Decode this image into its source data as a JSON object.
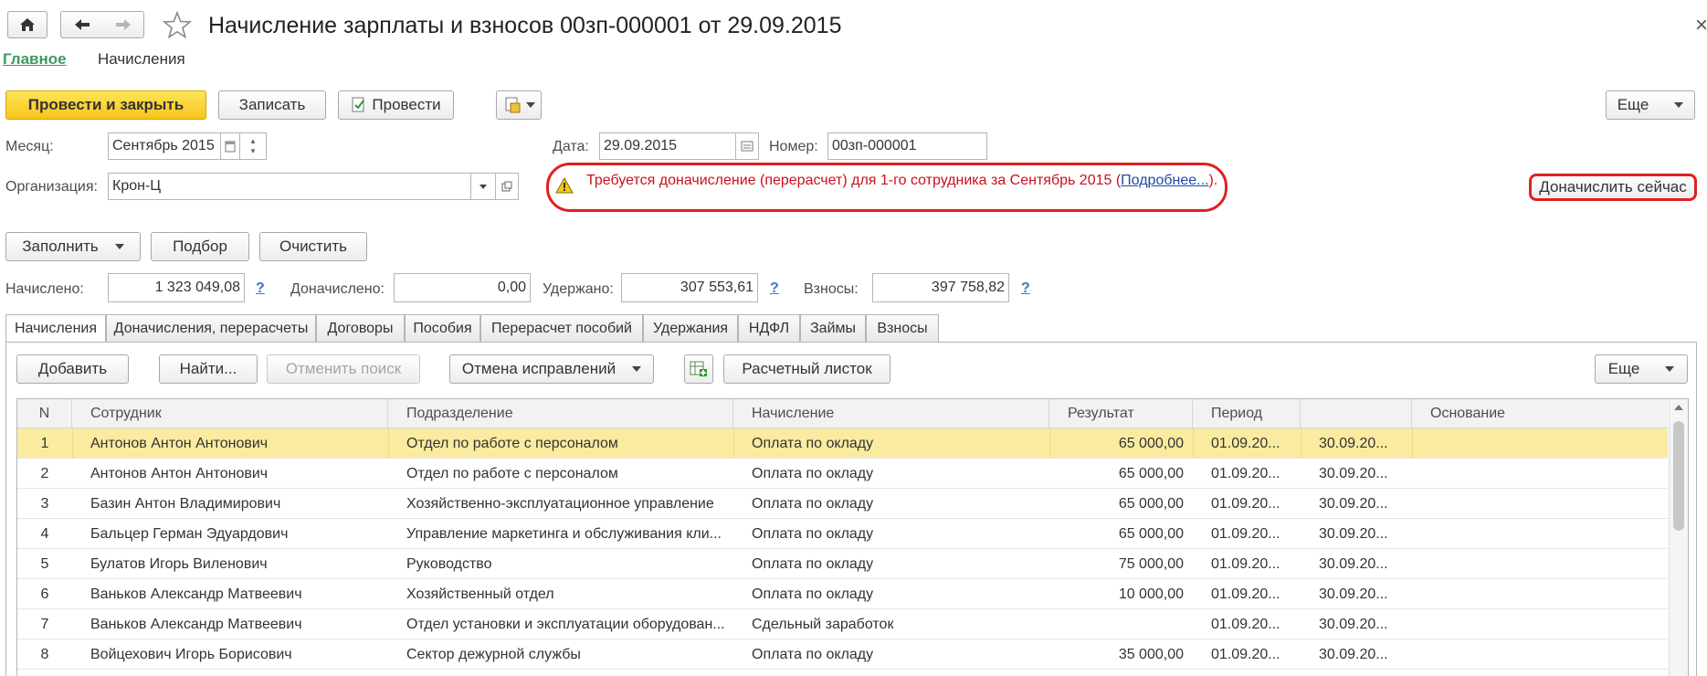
{
  "window": {
    "title": "Начисление зарплаты и взносов 00зп-000001 от 29.09.2015",
    "close_glyph": "×"
  },
  "nav": {
    "home_icon": "home-icon",
    "back_icon": "arrow-left-icon",
    "forward_icon": "arrow-right-icon",
    "star_icon": "star-icon",
    "links": [
      "Главное",
      "Начисления"
    ]
  },
  "toolbar": {
    "post_close": "Провести и закрыть",
    "save": "Записать",
    "post": "Провести",
    "more": "Еще"
  },
  "header": {
    "month_label": "Месяц:",
    "month_value": "Сентябрь 2015",
    "org_label": "Организация:",
    "org_value": "Крон-Ц",
    "date_label": "Дата:",
    "date_value": "29.09.2015",
    "number_label": "Номер:",
    "number_value": "00зп-000001"
  },
  "warning": {
    "text": "Требуется доначисление (перерасчет) для 1-го сотрудника за Сентябрь 2015 (",
    "link": "Подробнее...",
    "suffix": ").",
    "action_button": "Доначислить сейчас",
    "highlight_color": "#e02020"
  },
  "actions": {
    "fill": "Заполнить",
    "select": "Подбор",
    "clear": "Очистить"
  },
  "totals": {
    "accrued_label": "Начислено:",
    "accrued_value": "1 323 049,08",
    "extra_label": "Доначислено:",
    "extra_value": "0,00",
    "withheld_label": "Удержано:",
    "withheld_value": "307 553,61",
    "contrib_label": "Взносы:",
    "contrib_value": "397 758,82",
    "help": "?"
  },
  "tabs": [
    "Начисления",
    "Доначисления, перерасчеты",
    "Договоры",
    "Пособия",
    "Перерасчет пособий",
    "Удержания",
    "НДФЛ",
    "Займы",
    "Взносы"
  ],
  "grid_toolbar": {
    "add": "Добавить",
    "find": "Найти...",
    "cancel_search": "Отменить поиск",
    "cancel_fix": "Отмена исправлений",
    "payslip": "Расчетный листок",
    "more": "Еще"
  },
  "table": {
    "columns": [
      "N",
      "Сотрудник",
      "Подразделение",
      "Начисление",
      "Результат",
      "Период",
      "",
      "Основание"
    ],
    "rows": [
      {
        "n": "1",
        "employee": "Антонов Антон Антонович",
        "dept": "Отдел по работе с персоналом",
        "accrual": "Оплата по окладу",
        "result": "65 000,00",
        "from": "01.09.20...",
        "to": "30.09.20...",
        "basis": ""
      },
      {
        "n": "2",
        "employee": "Антонов Антон Антонович",
        "dept": "Отдел по работе с персоналом",
        "accrual": "Оплата по окладу",
        "result": "65 000,00",
        "from": "01.09.20...",
        "to": "30.09.20...",
        "basis": ""
      },
      {
        "n": "3",
        "employee": "Базин Антон Владимирович",
        "dept": "Хозяйственно-эксплуатационное управление",
        "accrual": "Оплата по окладу",
        "result": "65 000,00",
        "from": "01.09.20...",
        "to": "30.09.20...",
        "basis": ""
      },
      {
        "n": "4",
        "employee": "Бальцер Герман Эдуардович",
        "dept": "Управление маркетинга и обслуживания кли...",
        "accrual": "Оплата по окладу",
        "result": "65 000,00",
        "from": "01.09.20...",
        "to": "30.09.20...",
        "basis": ""
      },
      {
        "n": "5",
        "employee": "Булатов Игорь Виленович",
        "dept": "Руководство",
        "accrual": "Оплата по окладу",
        "result": "75 000,00",
        "from": "01.09.20...",
        "to": "30.09.20...",
        "basis": ""
      },
      {
        "n": "6",
        "employee": "Ваньков Александр Матвеевич",
        "dept": "Хозяйственный отдел",
        "accrual": "Оплата по окладу",
        "result": "10 000,00",
        "from": "01.09.20...",
        "to": "30.09.20...",
        "basis": ""
      },
      {
        "n": "7",
        "employee": "Ваньков Александр Матвеевич",
        "dept": "Отдел установки и эксплуатации оборудован...",
        "accrual": "Сдельный заработок",
        "result": "",
        "from": "01.09.20...",
        "to": "30.09.20...",
        "basis": ""
      },
      {
        "n": "8",
        "employee": "Войцехович Игорь Борисович",
        "dept": "Сектор дежурной службы",
        "accrual": "Оплата по окладу",
        "result": "35 000,00",
        "from": "01.09.20...",
        "to": "30.09.20...",
        "basis": ""
      }
    ],
    "selected_row": 0
  },
  "colors": {
    "selected_row": "#fbeba0",
    "primary_button": "#f6c61c",
    "link_green": "#3c9a5f",
    "warning_text": "#c8101e"
  }
}
